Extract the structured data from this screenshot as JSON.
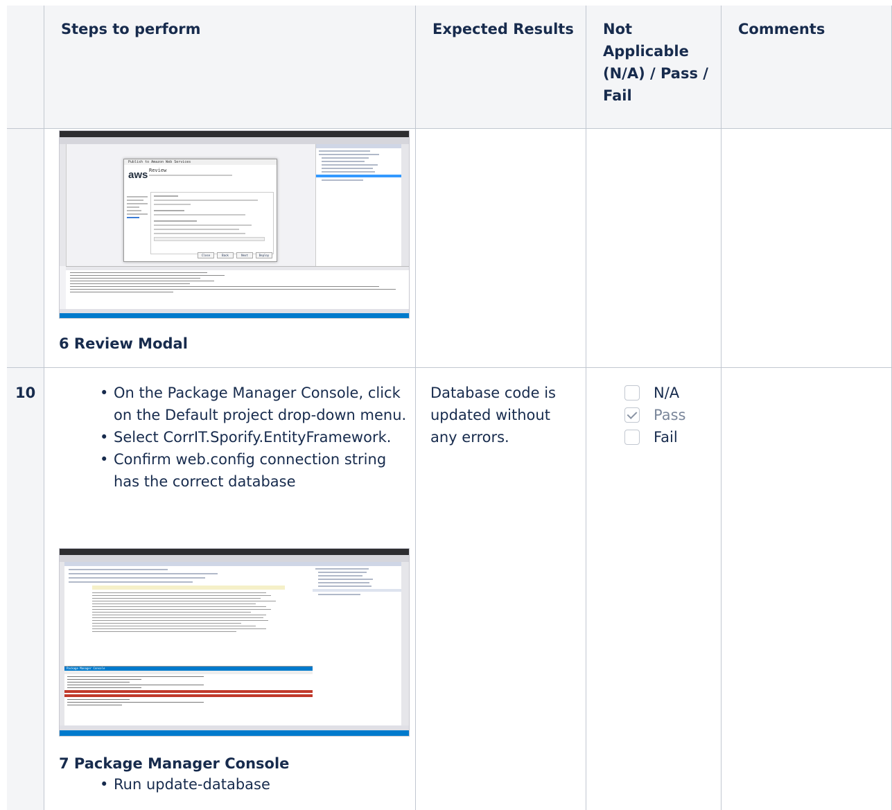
{
  "headers": {
    "col_steps": "Steps to perform",
    "col_expected": "Expected Results",
    "col_status": "Not Applicable (N/A) / Pass / Fail",
    "col_comments": "Comments"
  },
  "row_prev": {
    "screenshot_caption": "6 Review Modal",
    "screenshot": {
      "dialog_title": "Publish to Amazon Web Services",
      "dialog_heading": "Review",
      "dialog_logo": "aws",
      "buttons": [
        "Close",
        "Back",
        "Next",
        "Deploy"
      ]
    }
  },
  "row_10": {
    "number": "10",
    "steps": [
      "On the Package Manager Console, click on the Default project drop-down menu.",
      "Select CorrIT.Sporify.EntityFramework.",
      "Confirm web.config connection string has the correct database"
    ],
    "screenshot_caption": "7 Package Manager Console",
    "sub_steps": [
      "Run update-database"
    ],
    "expected": "Database code is updated without any errors.",
    "status_options": [
      {
        "label": "N/A",
        "checked": false
      },
      {
        "label": "Pass",
        "checked": true
      },
      {
        "label": "Fail",
        "checked": false
      }
    ],
    "screenshot": {
      "panel_title": "Package Manager Console"
    }
  },
  "colors": {
    "header_bg": "#f4f5f7",
    "border": "#c1c7d0",
    "text": "#172b4d",
    "vs_blue": "#007acc",
    "vs_red": "#c0392b"
  }
}
